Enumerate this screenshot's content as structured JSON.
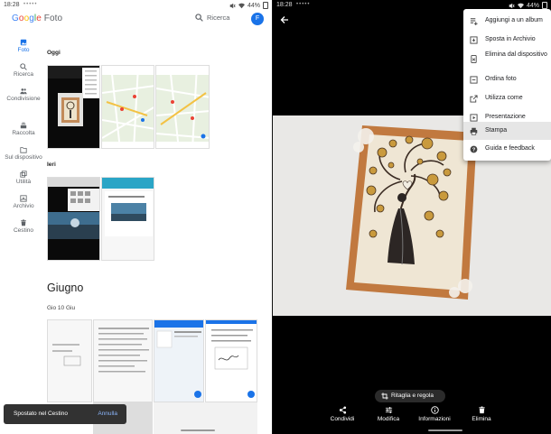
{
  "left": {
    "status": {
      "time": "18:28",
      "dots": "•••••",
      "battery": "44%"
    },
    "app": {
      "logo_google": "Google",
      "logo_foto": "Foto",
      "search_label": "Ricerca",
      "avatar_initial": "F"
    },
    "nav": [
      {
        "label": "Foto",
        "icon": "photo-icon"
      },
      {
        "label": "Ricerca",
        "icon": "search-icon"
      },
      {
        "label": "Condivisione",
        "icon": "people-icon"
      },
      {
        "label": "Raccolta",
        "icon": "library-icon"
      },
      {
        "label": "Sul dispositivo",
        "icon": "folder-icon"
      },
      {
        "label": "Utilità",
        "icon": "utilities-icon"
      },
      {
        "label": "Archivio",
        "icon": "archive-icon"
      },
      {
        "label": "Cestino",
        "icon": "trash-icon"
      }
    ],
    "sections": {
      "today": "Oggi",
      "yesterday": "Ieri",
      "month": "Giugno",
      "date": "Gio 10 Giu"
    },
    "toast": {
      "message": "Spostato nel Cestino",
      "action": "Annulla"
    }
  },
  "right": {
    "status": {
      "time": "18:28",
      "dots": "•••••",
      "battery": "44%"
    },
    "menu": [
      {
        "label": "Aggiungi a un album",
        "icon": "playlist-add-icon"
      },
      {
        "label": "Sposta in Archivio",
        "icon": "archive-icon"
      },
      {
        "label": "Elimina dal dispositivo",
        "icon": "phone-delete-icon"
      },
      {
        "label": "Ordina foto",
        "icon": "order-icon"
      },
      {
        "label": "Utilizza come",
        "icon": "open-in-icon"
      },
      {
        "label": "Presentazione",
        "icon": "slideshow-icon"
      },
      {
        "label": "Stampa",
        "icon": "print-icon"
      },
      {
        "label": "Guida e feedback",
        "icon": "help-icon"
      }
    ],
    "crop_chip": "Ritaglia e regola",
    "actions": [
      {
        "label": "Condividi",
        "icon": "share-icon"
      },
      {
        "label": "Modifica",
        "icon": "edit-sliders-icon"
      },
      {
        "label": "Informazioni",
        "icon": "info-icon"
      },
      {
        "label": "Elimina",
        "icon": "trash-icon"
      }
    ]
  },
  "colors": {
    "accent": "#1a73e8",
    "menu_selected": "#e6e6e6",
    "toast_action": "#8ab4f8"
  }
}
